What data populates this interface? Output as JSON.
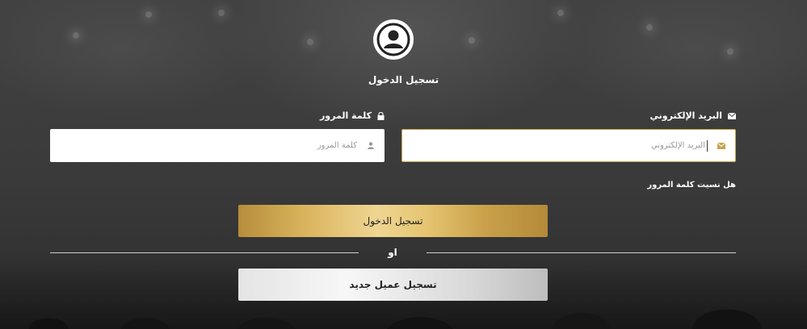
{
  "header": {
    "title": "تسجيل الدخول",
    "avatar_icon": "user-avatar-icon"
  },
  "form": {
    "email": {
      "label": "البريد الإلكتروني",
      "placeholder": "البريد الإلكتروني",
      "value": "",
      "icon": "envelope-icon"
    },
    "password": {
      "label": "كلمة المرور",
      "placeholder": "كلمة المرور",
      "value": "",
      "icon": "lock-icon"
    },
    "forgot_link": "هل نسيت كلمة المرور",
    "login_button": "تسجيل الدخول",
    "divider_text": "او",
    "register_button": "تسجيل عميل جديد"
  },
  "colors": {
    "accent_gold": "#c9a44f",
    "background": "#3a3a3a"
  }
}
